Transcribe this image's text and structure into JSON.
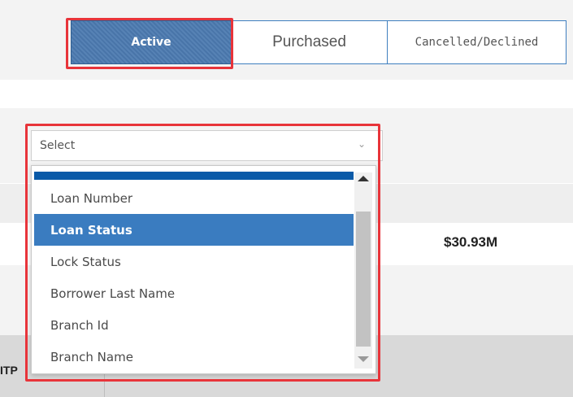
{
  "tabs": [
    {
      "label": "Active",
      "active": true
    },
    {
      "label": "Purchased",
      "active": false
    },
    {
      "label": "Cancelled/Declined",
      "active": false
    }
  ],
  "filter": {
    "placeholder": "Select",
    "options": [
      {
        "label": "Loan Number"
      },
      {
        "label": "Loan Status",
        "selected": true
      },
      {
        "label": "Lock Status"
      },
      {
        "label": "Borrower Last Name"
      },
      {
        "label": "Branch Id"
      },
      {
        "label": "Branch Name"
      }
    ]
  },
  "summary": {
    "amount": "$30.93M"
  },
  "table_fragment": {
    "label": "ITP"
  },
  "colors": {
    "accent": "#3a7cc0",
    "highlight": "#e8343a",
    "tab_active": "#4c7ab0"
  },
  "icons": [
    "chevron-down-icon",
    "scroll-up-arrow-icon",
    "scroll-down-arrow-icon"
  ]
}
